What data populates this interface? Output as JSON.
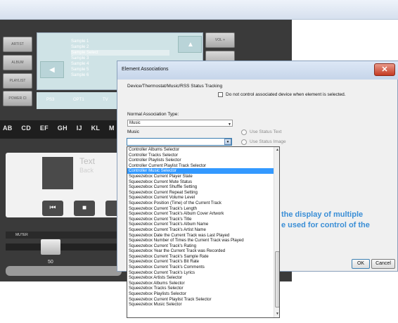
{
  "editor": {
    "side_buttons": [
      "ARTIST",
      "ALBUM",
      "PLAYLIST",
      "POWER CI"
    ],
    "volume_button": "VOL +",
    "browser_items": [
      "Sample 1",
      "Sample 2",
      "Sample Select",
      "Sample 3",
      "Sample 4",
      "Sample 5",
      "Sample 6"
    ],
    "source_row": [
      "PS3",
      "OPT1",
      "TV"
    ],
    "letter_buttons": [
      "AB",
      "CD",
      "EF",
      "GH",
      "IJ",
      "KL",
      "M"
    ],
    "now_playing_text": "Text",
    "now_playing_back": "Back",
    "transport": [
      "previous",
      "stop",
      "play"
    ],
    "mute_label": "MUTER",
    "slider_value": "50"
  },
  "dialog": {
    "title": "Element Associations",
    "close_label": "✕",
    "status_tracking_label": "Device/Thermostat/Music/RSS Status Tracking",
    "dont_control_label": "Do not control associated device when element is selected.",
    "normal_assoc_label": "Normal Association Type:",
    "normal_assoc_value": "Music",
    "music_label": "Music",
    "music_value": "",
    "use_status_text": "Use Status Text",
    "use_status_image": "Use Status Image",
    "ok_label": "OK",
    "cancel_label": "Cancel",
    "background_text_line1": "the display of multiple",
    "background_text_line2": "e used for control of the"
  },
  "dropdown": {
    "selected_index": 4,
    "items": [
      "Controller Albums Selector",
      "Controller Tracks Selector",
      "Controller Playlists Selector",
      "Controller Current Playlist Track Selector",
      "Controller Music Selector",
      "Squeezebox Current Player State",
      "Squeezebox Current Mute Status",
      "Squeezebox Current Shuffle Setting",
      "Squeezebox Current Repeat Setting",
      "Squeezebox Current Volume Level",
      "Squeezebox Position (Time) of the Current Track",
      "Squeezebox Current Track's Length",
      "Squeezebox Current Track's Album Cover Artwork",
      "Squeezebox Current Track's Title",
      "Squeezebox Current Track's Album Name",
      "Squeezebox Current Track's Artist Name",
      "Squeezebox Date the Current Track was Last Played",
      "Squeezebox Number of Times the Current Track was Played",
      "Squeezebox Current Track's Rating",
      "Squeezebox Year the Current Track was Recorded",
      "Squeezebox Current Track's Sample Rate",
      "Squeezebox Current Track's Bit Rate",
      "Squeezebox Current Track's Comments",
      "Squeezebox Current Track's Lyrics",
      "Squeezebox Artists Selector",
      "Squeezebox Albums Selector",
      "Squeezebox Tracks Selector",
      "Squeezebox Playlists Selector",
      "Squeezebox Current Playlist Track Selector",
      "Squeezebox Music Selector"
    ]
  }
}
